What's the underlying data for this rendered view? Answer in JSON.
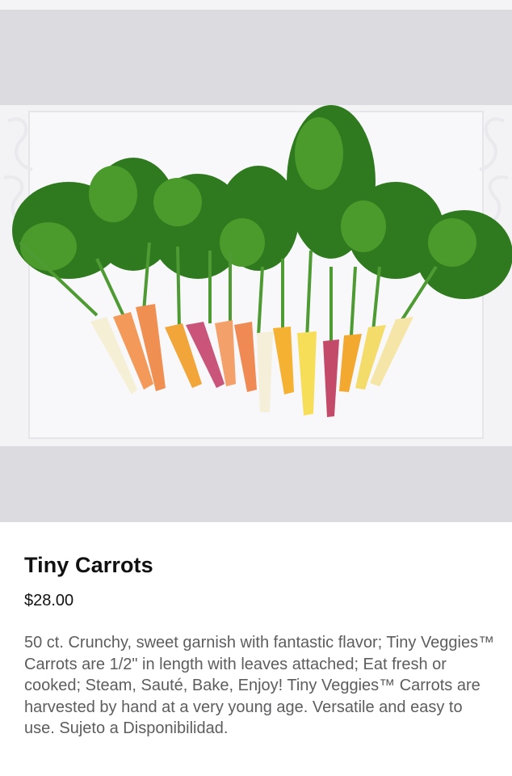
{
  "product": {
    "image": "carrots-photo",
    "name": "Tiny Carrots",
    "price": "$28.00",
    "description": "50 ct. Crunchy, sweet garnish with fantastic flavor; Tiny Veggies™ Carrots are 1/2\" in length with leaves attached; Eat fresh or cooked; Steam, Sauté, Bake, Enjoy! Tiny Veggies™ Carrots are harvested by hand at a very young age. Versatile and easy to use. Sujeto a Disponibilidad."
  },
  "colors": {
    "image_background": "#dcdbe0",
    "title": "#111111",
    "description": "#5d5d60"
  }
}
